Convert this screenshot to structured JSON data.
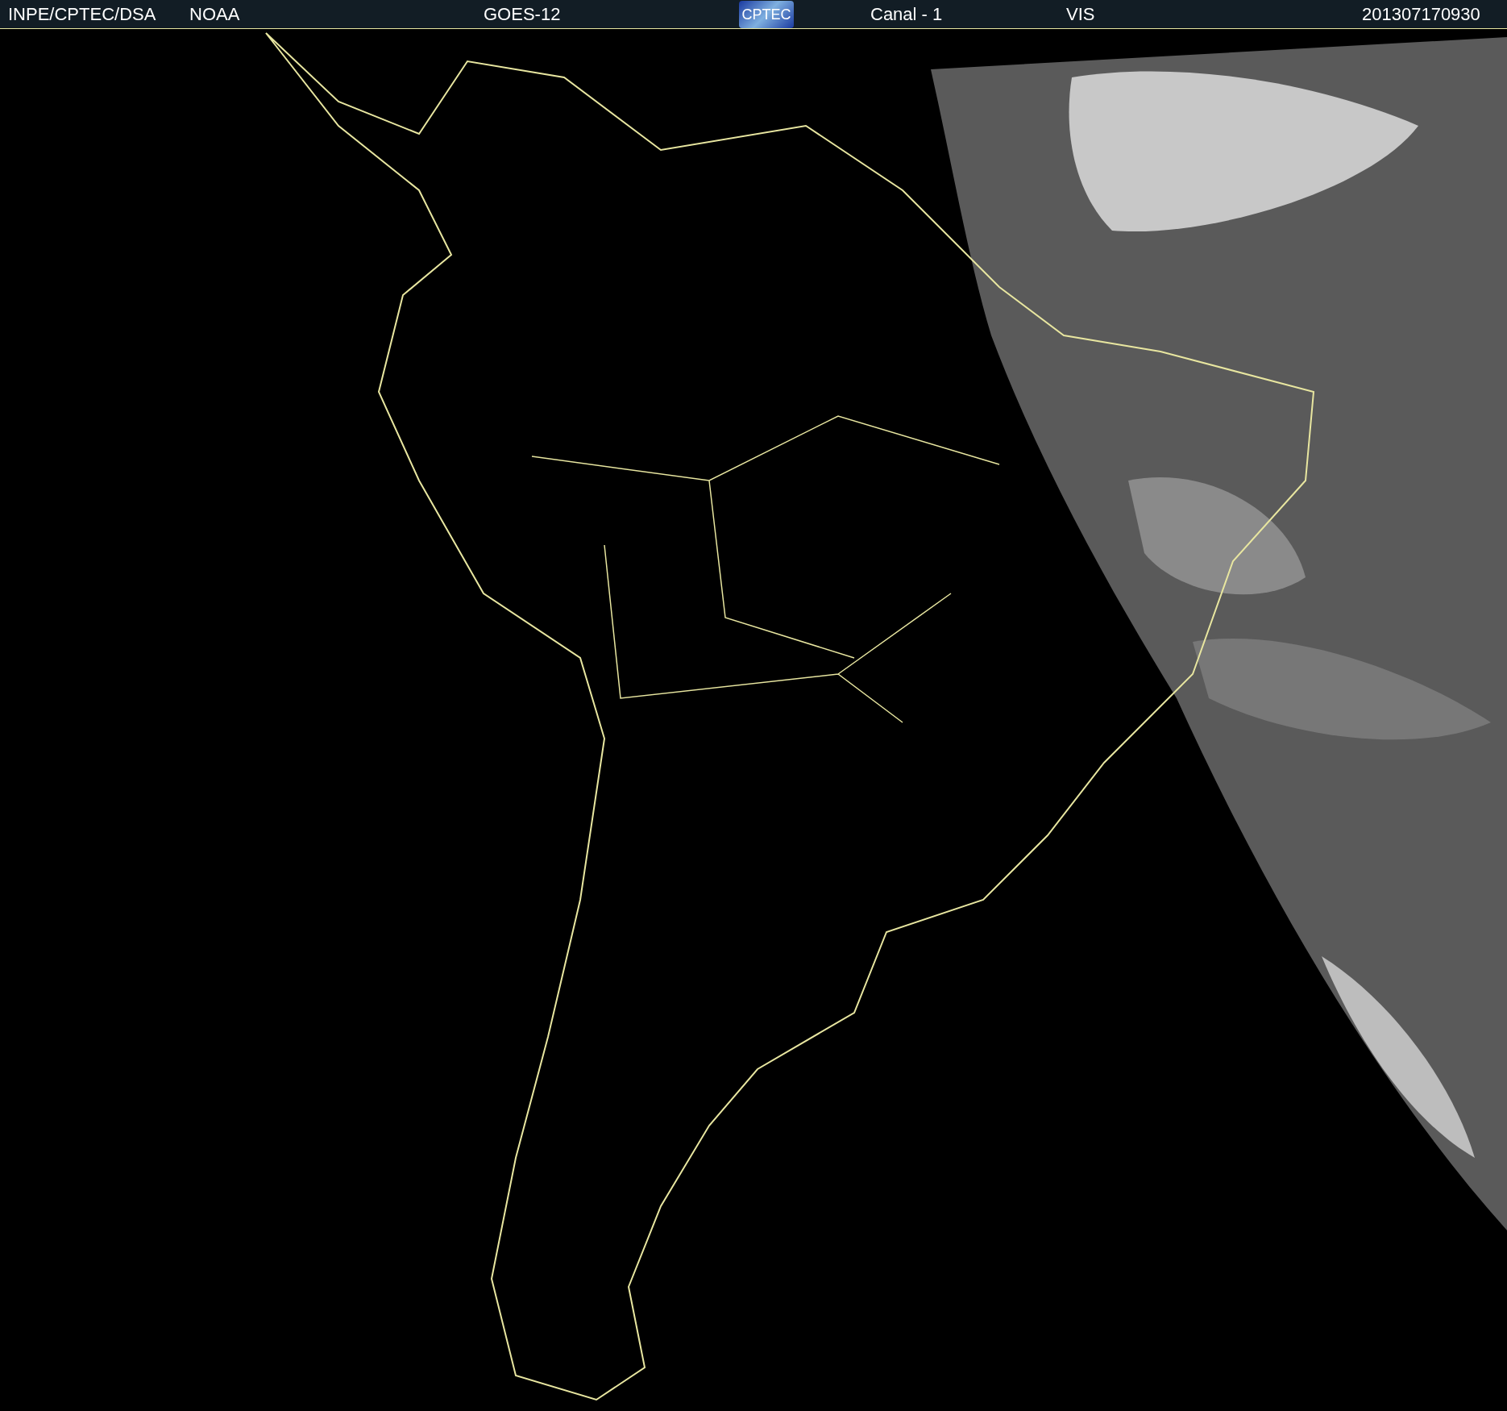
{
  "header": {
    "items": [
      {
        "kind": "text",
        "text": "INPE/CPTEC/DSA"
      },
      {
        "kind": "text",
        "text": "NOAA"
      },
      {
        "kind": "text",
        "text": "GOES-12"
      },
      {
        "kind": "logo",
        "text": "CPTEC"
      },
      {
        "kind": "text",
        "text": "Canal - 1"
      },
      {
        "kind": "text",
        "text": "VIS"
      },
      {
        "kind": "text",
        "text": "201307170930"
      }
    ]
  }
}
